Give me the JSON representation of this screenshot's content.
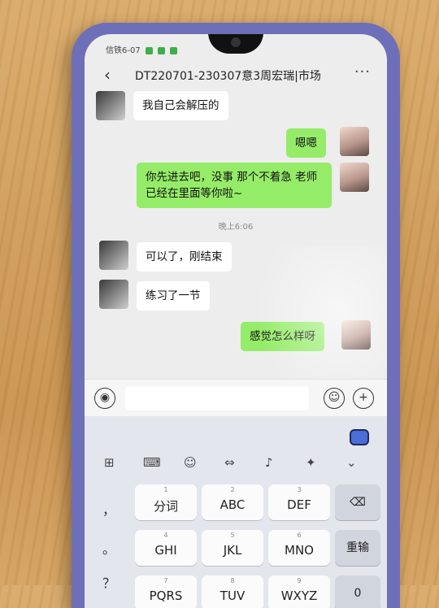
{
  "status": {
    "carrier": "信铁6-07"
  },
  "header": {
    "back_icon": "‹",
    "title": "DT220701-230307意3周宏瑞|市场",
    "more_icon": "···"
  },
  "messages": [
    {
      "side": "in",
      "text": "我自己会解压的"
    },
    {
      "side": "out",
      "text": "嗯嗯"
    },
    {
      "side": "out",
      "text": "你先进去吧，没事 那个不着急 老师已经在里面等你啦~"
    },
    {
      "side": "in",
      "text": "可以了，刚结束"
    },
    {
      "side": "in",
      "text": "练习了一节"
    },
    {
      "side": "out",
      "text": "感觉怎么样呀"
    }
  ],
  "timestamp": "晚上6:06",
  "input_bar": {
    "voice_icon": "voice-icon",
    "emoji_icon": "emoji-icon",
    "plus_icon": "plus-icon"
  },
  "keyboard": {
    "toolbar": [
      "grid-icon",
      "keyboard-icon",
      "emoji-icon",
      "cursor-icon",
      "mic-icon",
      "skin-icon",
      "chevron-down-icon"
    ],
    "left_column": [
      "，",
      "。",
      "？"
    ],
    "keys": [
      {
        "num": "1",
        "label": "分词"
      },
      {
        "num": "2",
        "label": "ABC"
      },
      {
        "num": "3",
        "label": "DEF"
      },
      {
        "num": "4",
        "label": "GHI"
      },
      {
        "num": "5",
        "label": "JKL"
      },
      {
        "num": "6",
        "label": "MNO"
      },
      {
        "num": "7",
        "label": "PQRS"
      },
      {
        "num": "8",
        "label": "TUV"
      },
      {
        "num": "9",
        "label": "WXYZ"
      }
    ],
    "delete_icon": "⌫",
    "reenter_label": "重输",
    "zero_label": "0"
  },
  "colors": {
    "out_bubble": "#95ec69",
    "in_bubble": "#ffffff",
    "phone_frame": "#6d6fb8"
  }
}
